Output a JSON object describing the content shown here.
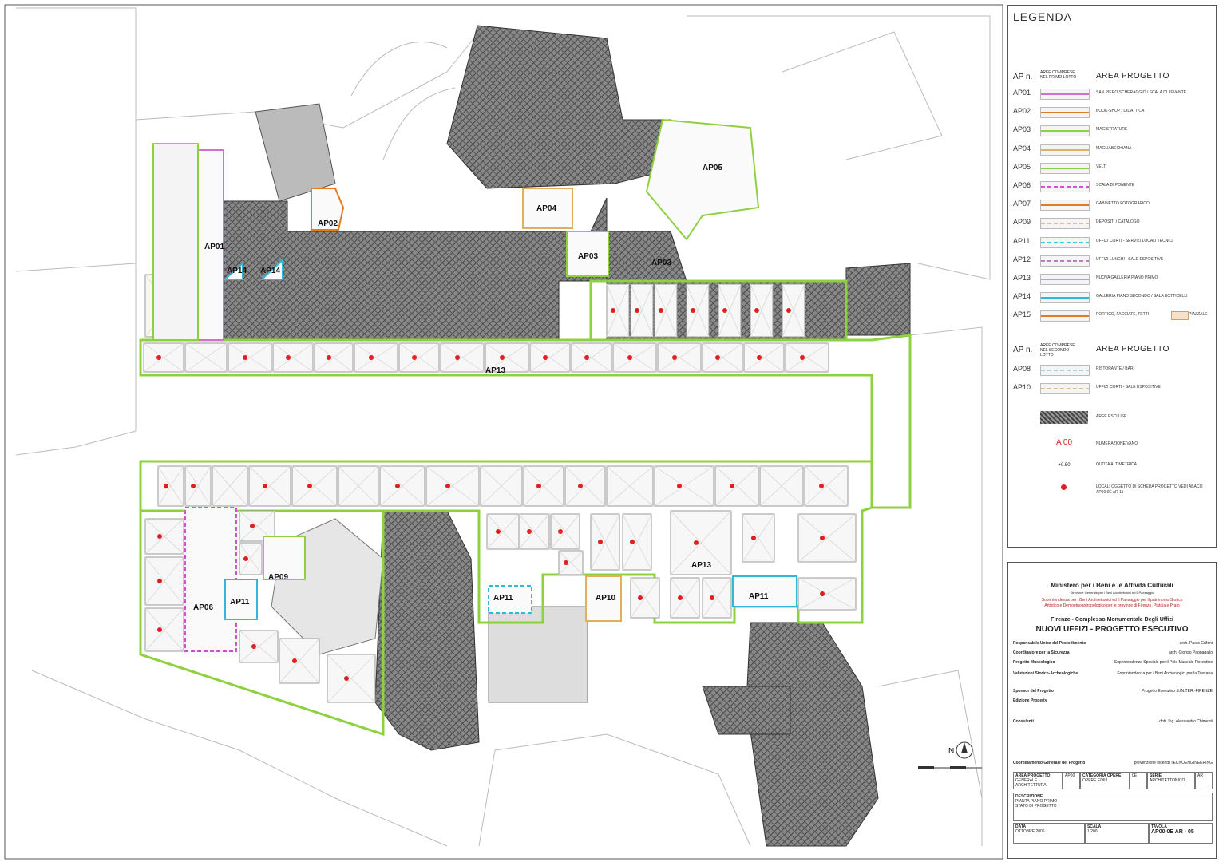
{
  "legend": {
    "title": "LEGENDA",
    "header1": {
      "col1": "AP n.",
      "col2": "AREE COMPRESE NEL PRIMO LOTTO",
      "col3": "AREA PROGETTO"
    },
    "rows1": [
      {
        "code": "AP01",
        "desc": "SAN PIERO SCHERAGGIO / SCALA DI LEVANTE",
        "color": "#d070d0",
        "dash": false
      },
      {
        "code": "AP02",
        "desc": "BOOK-SHOP / DIDATTICA",
        "color": "#e07b20",
        "dash": false
      },
      {
        "code": "AP03",
        "desc": "MAGISTRATURE",
        "color": "#8dd040",
        "dash": false
      },
      {
        "code": "AP04",
        "desc": "MAGLIABECHIANA",
        "color": "#e0b060",
        "dash": false
      },
      {
        "code": "AP05",
        "desc": "VELTI",
        "color": "#8dd040",
        "dash": false
      },
      {
        "code": "AP06",
        "desc": "SCALA DI PONENTE",
        "color": "#d050d0",
        "dash": true
      },
      {
        "code": "AP07",
        "desc": "GABINETTO FOTOGRAFICO",
        "color": "#e07b20",
        "dash": false
      },
      {
        "code": "AP09",
        "desc": "DEPOSITI / CATALOGO",
        "color": "#e0c080",
        "dash": true
      },
      {
        "code": "AP11",
        "desc": "UFFIZI CORTI - SERVIZI LOCALI TECNICI",
        "color": "#40c8e0",
        "dash": true
      },
      {
        "code": "AP12",
        "desc": "UFFIZI LUNGHI - SALE ESPOSITIVE",
        "color": "#d070d0",
        "dash": true
      },
      {
        "code": "AP13",
        "desc": "NUOVA GALLERIA PIANO PRIMO",
        "color": "#8dd040",
        "dash": false
      },
      {
        "code": "AP14",
        "desc": "GALLERIA PIANO SECONDO / SALA BOTTICELLI",
        "color": "#30b8d8",
        "dash": false
      },
      {
        "code": "AP15",
        "desc": "PORTICO, FACCIATE, TETTI",
        "color": "#e07b20",
        "dash": false,
        "extra": "PIAZZALE"
      }
    ],
    "header2": {
      "col1": "AP n.",
      "col2": "AREE COMPRESE NEL SECONDO LOTTO",
      "col3": "AREA PROGETTO"
    },
    "rows2": [
      {
        "code": "AP08",
        "desc": "RISTORANTE / BAR",
        "color": "#a0d8e0",
        "dash": true
      },
      {
        "code": "AP10",
        "desc": "UFFIZI CORTI - SALE ESPOSITIVE",
        "color": "#e0c080",
        "dash": true
      }
    ],
    "symbols": [
      {
        "kind": "hatch",
        "desc": "AREE ESCLUSE"
      },
      {
        "kind": "room-number",
        "label": "A 00",
        "desc": "NUMERAZIONE VANO"
      },
      {
        "kind": "elevation",
        "label": "+0.50",
        "desc": "QUOTA ALTIMETRICA"
      },
      {
        "kind": "dot",
        "desc": "LOCALI OGGETTO DI SCHEDA PROGETTO VEDI ABACO AP00 0E AR 11"
      }
    ]
  },
  "title_block": {
    "ministry": "Ministero per i Beni e le Attività Culturali",
    "ministry_sub": "Direzione Generale per i Beni Architettonici ed il Paesaggio",
    "soprintendenza1": "Soprintendenza per i Beni Architettonici ed il Paesaggio per il patrimonio Storico",
    "soprintendenza2": "Artistico e Demoetnoantropologico per le province di Firenze, Pistoia e Prato",
    "complex": "Firenze - Complesso Monumentale Degli Uffizi",
    "project": "NUOVI UFFIZI - PROGETTO ESECUTIVO",
    "credits": [
      {
        "role": "Responsabile Unico del Procedimento",
        "name": "arch. Paolo Grifoni"
      },
      {
        "role": "Coordinatore per la Sicurezza",
        "name": "arch. Giorgio Pappagallo"
      },
      {
        "role": "Progetto Museologico",
        "name": "Soprintendenza Speciale per il Polo Museale Fiorentino"
      },
      {
        "role": "Valutazioni Storico-Archeologiche",
        "name": "Soprintendenza per i Beni Archeologici per la Toscana"
      },
      {
        "role": "Sponsor del Progetto",
        "name": "Progetto Esecutivo S.IN.TER.-FIRENZE"
      },
      {
        "role": "Consulenti",
        "name": "dott. Ing. Alessandro Chimenti"
      },
      {
        "role": "Coordinamento Generale del Progetto",
        "name": "prevenzione incendi TECNOENGINEERING"
      }
    ],
    "sponsor": "Edizione Property",
    "cells": {
      "area_label": "AREA PROGETTO",
      "area_value": "GENERALE ARCHITETTURA",
      "area_code": "AP00",
      "cat_label": "CATEGORIA OPERE",
      "cat_value": "OPERE EDILI",
      "cat_code": "0E",
      "series_label": "SERIE",
      "series_value": "ARCHITETTONICO",
      "series_code": "AR",
      "desc_label": "DESCRIZIONE",
      "desc_value1": "PIANTA PIANO PRIMO",
      "desc_value2": "STATO DI PROGETTO",
      "date_label": "DATA",
      "date_value": "OTTOBRE 2006",
      "scale_label": "SCALA",
      "scale_value": "1/200",
      "sheet_label": "TAVOLA",
      "sheet_value": "AP00 0E AR - 05"
    }
  },
  "plan": {
    "area_labels": [
      "AP01",
      "AP02",
      "AP04",
      "AP05",
      "AP03",
      "AP03",
      "AP14",
      "AP14",
      "AP13",
      "AP09",
      "AP11",
      "AP06",
      "AP11",
      "AP10",
      "AP13",
      "AP11"
    ],
    "north": "N"
  },
  "colors": {
    "green": "#8dd040",
    "magenta": "#d070d0",
    "orange": "#e07b20",
    "cyan": "#30b8d8",
    "tan": "#e0b060",
    "red": "#e02020"
  }
}
